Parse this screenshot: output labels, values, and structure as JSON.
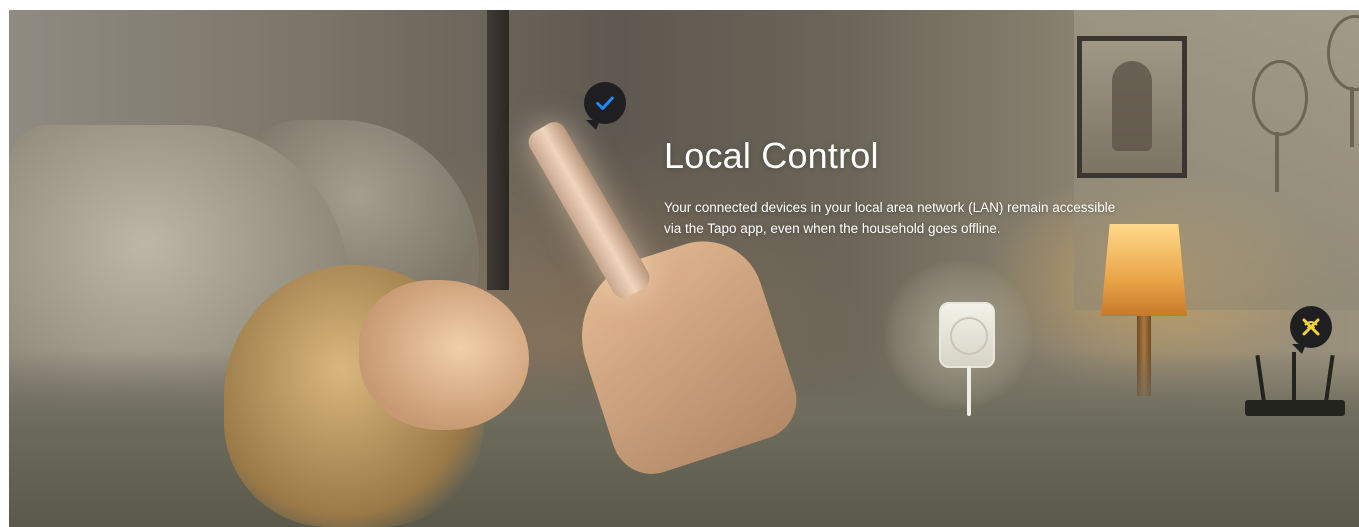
{
  "hero": {
    "title": "Local Control",
    "description": "Your connected devices in your local area network (LAN) remain accessible via the Tapo app, even when the household goes offline."
  },
  "badges": {
    "online": {
      "icon": "checkmark-icon",
      "color": "#1a8cff"
    },
    "offline": {
      "icon": "disconnected-icon",
      "color": "#f2d33a"
    }
  },
  "colors": {
    "text": "#ffffff",
    "badge_bg": "#1f1f22"
  }
}
